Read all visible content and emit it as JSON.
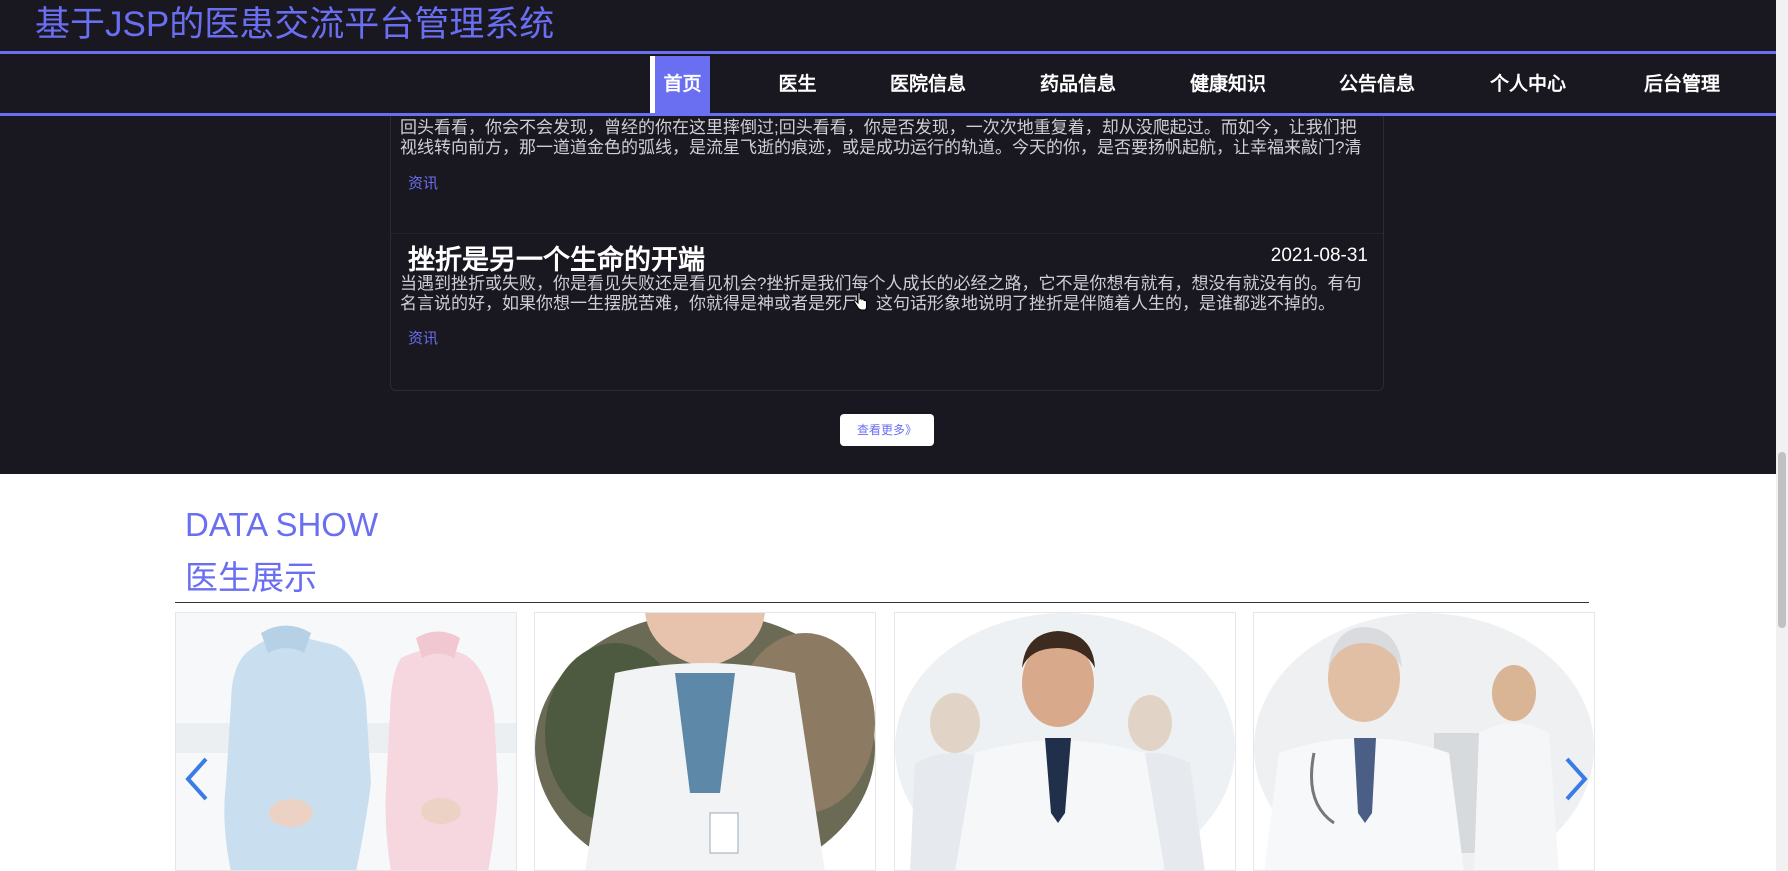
{
  "header": {
    "title": "基于JSP的医患交流平台管理系统"
  },
  "nav": {
    "items": [
      {
        "label": "首页",
        "active": true
      },
      {
        "label": "医生"
      },
      {
        "label": "医院信息"
      },
      {
        "label": "药品信息"
      },
      {
        "label": "健康知识"
      },
      {
        "label": "公告信息"
      },
      {
        "label": "个人中心"
      },
      {
        "label": "后台管理"
      }
    ]
  },
  "news": {
    "items": [
      {
        "excerpt": "回头看看，你会不会发现，曾经的你在这里摔倒过;回头看看，你是否发现，一次次地重复着，却从没爬起过。而如今，让我们把视线转向前方，那一道道金色的弧线，是流星飞逝的痕迹，或是成功运行的轨道。今天的你，是否要扬帆起航，让幸福来敲门?清晨...",
        "tag": "资讯"
      },
      {
        "title": "挫折是另一个生命的开端",
        "date": "2021-08-31",
        "excerpt": "当遇到挫折或失败，你是看见失败还是看见机会?挫折是我们每个人成长的必经之路，它不是你想有就有，想没有就没有的。有句名言说的好，如果你想一生摆脱苦难，你就得是神或者是死尸。这句话形象地说明了挫折是伴随着人生的，是谁都逃不掉的。",
        "tag": "资讯"
      }
    ],
    "more_label": "查看更多》"
  },
  "doctors": {
    "section_en": "DATA SHOW",
    "section_cn": "医生展示"
  },
  "colors": {
    "accent": "#6a6ef0",
    "dark_bg": "#19171f"
  }
}
